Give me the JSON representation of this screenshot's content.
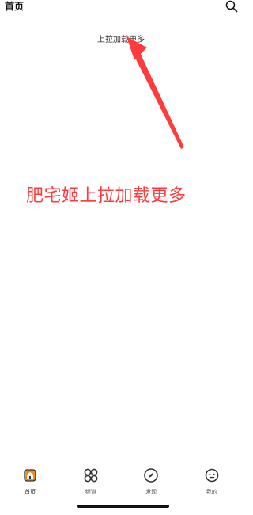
{
  "header": {
    "title": "首页"
  },
  "pull_hint": "上拉加载更多",
  "annotation": {
    "text": "肥宅姬上拉加载更多",
    "color": "#ff3b3b"
  },
  "tabbar": {
    "active": "首页",
    "items": [
      {
        "label": "首页",
        "icon": "home-icon"
      },
      {
        "label": "频道",
        "icon": "grid-icon"
      },
      {
        "label": "发现",
        "icon": "compass-icon"
      },
      {
        "label": "我的",
        "icon": "face-icon"
      }
    ]
  },
  "colors": {
    "accent": "#f08a1c",
    "annotation": "#ff3b3b",
    "text": "#111111"
  }
}
